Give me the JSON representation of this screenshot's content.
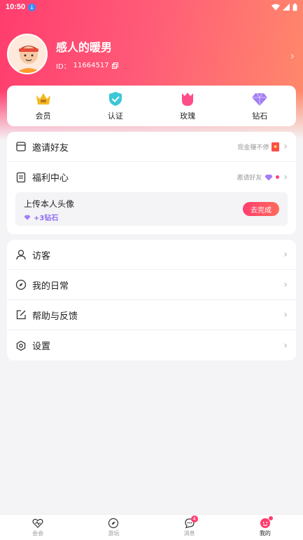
{
  "status_bar": {
    "time": "10:50"
  },
  "profile": {
    "username": "感人的暖男",
    "id_label": "ID：",
    "id_value": "11664517"
  },
  "quick_actions": [
    {
      "label": "会员",
      "icon": "crown-icon"
    },
    {
      "label": "认证",
      "icon": "shield-check-icon"
    },
    {
      "label": "玫瑰",
      "icon": "rose-icon"
    },
    {
      "label": "钻石",
      "icon": "diamond-icon"
    }
  ],
  "menu_top": {
    "invite": {
      "label": "邀请好友",
      "hint": "现金赚不停"
    },
    "welfare": {
      "label": "福利中心",
      "hint": "邀请好友"
    },
    "task": {
      "title": "上传本人头像",
      "reward": "+3钻石",
      "button": "去完成"
    }
  },
  "menu_bottom": [
    {
      "label": "访客",
      "icon": "user-icon"
    },
    {
      "label": "我的日常",
      "icon": "compass-icon"
    },
    {
      "label": "帮助与反馈",
      "icon": "edit-icon"
    },
    {
      "label": "设置",
      "icon": "settings-icon"
    }
  ],
  "bottom_nav": [
    {
      "label": "会会",
      "icon": "heart-icon",
      "active": false
    },
    {
      "label": "游玩",
      "icon": "compass-icon",
      "active": false
    },
    {
      "label": "消息",
      "icon": "chat-icon",
      "active": false,
      "badge": "4"
    },
    {
      "label": "我的",
      "icon": "profile-icon",
      "active": true
    }
  ],
  "colors": {
    "accent": "#ff3d6e",
    "diamond": "#8e6cf0"
  }
}
